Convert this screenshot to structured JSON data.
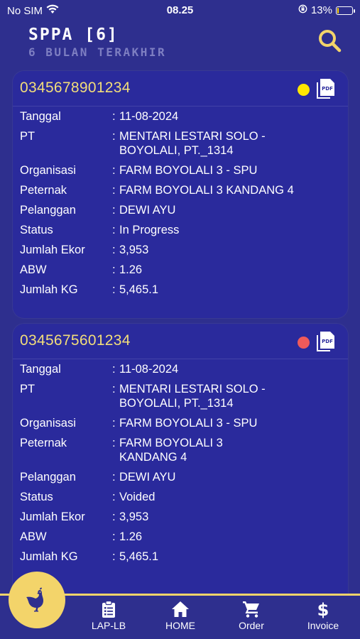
{
  "status_bar": {
    "carrier": "No SIM",
    "time": "08.25",
    "battery": "13%",
    "battery_level": 0.13
  },
  "header": {
    "title": "SPPA [6]",
    "subtitle": "6 BULAN TERAKHIR"
  },
  "colors": {
    "background": "#2E2F8E",
    "card": "#2A2A9C",
    "accent": "#F3D46A",
    "status_in_progress": "#FFE600",
    "status_voided": "#F05A5A"
  },
  "cards": [
    {
      "number": "0345678901234",
      "status_color": "#FFE600",
      "fields": {
        "tanggal": {
          "label": "Tanggal",
          "colon": ":",
          "value": "11-08-2024"
        },
        "pt": {
          "label": "PT",
          "colon": ":",
          "value": "MENTARI LESTARI SOLO -",
          "value2": "BOYOLALI, PT._1314"
        },
        "organisasi": {
          "label": "Organisasi",
          "colon": ":",
          "value": "FARM BOYOLALI 3 - SPU"
        },
        "peternak": {
          "label": "Peternak",
          "colon": ":",
          "value": "FARM BOYOLALI 3 KANDANG 4"
        },
        "pelanggan": {
          "label": "Pelanggan",
          "colon": ":",
          "value": "DEWI AYU"
        },
        "status": {
          "label": "Status",
          "colon": ":",
          "value": "In Progress"
        },
        "jumlah_ekor": {
          "label": "Jumlah Ekor",
          "colon": ":",
          "value": "3,953"
        },
        "abw": {
          "label": "ABW",
          "colon": ":",
          "value": "1.26"
        },
        "jumlah_kg": {
          "label": "Jumlah KG",
          "colon": ":",
          "value": "5,465.1"
        }
      }
    },
    {
      "number": "0345675601234",
      "status_color": "#F05A5A",
      "fields": {
        "tanggal": {
          "label": "Tanggal",
          "colon": ":",
          "value": "11-08-2024"
        },
        "pt": {
          "label": "PT",
          "colon": ":",
          "value": "MENTARI LESTARI SOLO -",
          "value2": "BOYOLALI, PT._1314"
        },
        "organisasi": {
          "label": "Organisasi",
          "colon": ":",
          "value": "FARM BOYOLALI 3 - SPU"
        },
        "peternak": {
          "label": "Peternak",
          "colon": ":",
          "value": "FARM BOYOLALI 3",
          "value2": "KANDANG 4"
        },
        "pelanggan": {
          "label": "Pelanggan",
          "colon": ":",
          "value": "DEWI AYU"
        },
        "status": {
          "label": "Status",
          "colon": ":",
          "value": "Voided"
        },
        "jumlah_ekor": {
          "label": "Jumlah Ekor",
          "colon": ":",
          "value": "3,953"
        },
        "abw": {
          "label": "ABW",
          "colon": ":",
          "value": "1.26"
        },
        "jumlah_kg": {
          "label": "Jumlah KG",
          "colon": ":",
          "value": "5,465.1"
        }
      }
    }
  ],
  "bottom_nav": {
    "items": [
      {
        "label": "LAP-LB",
        "icon": "clipboard-icon"
      },
      {
        "label": "HOME",
        "icon": "home-icon"
      },
      {
        "label": "Order",
        "icon": "cart-icon"
      },
      {
        "label": "Invoice",
        "icon": "dollar-icon"
      }
    ],
    "fab_icon": "chicken-icon"
  }
}
